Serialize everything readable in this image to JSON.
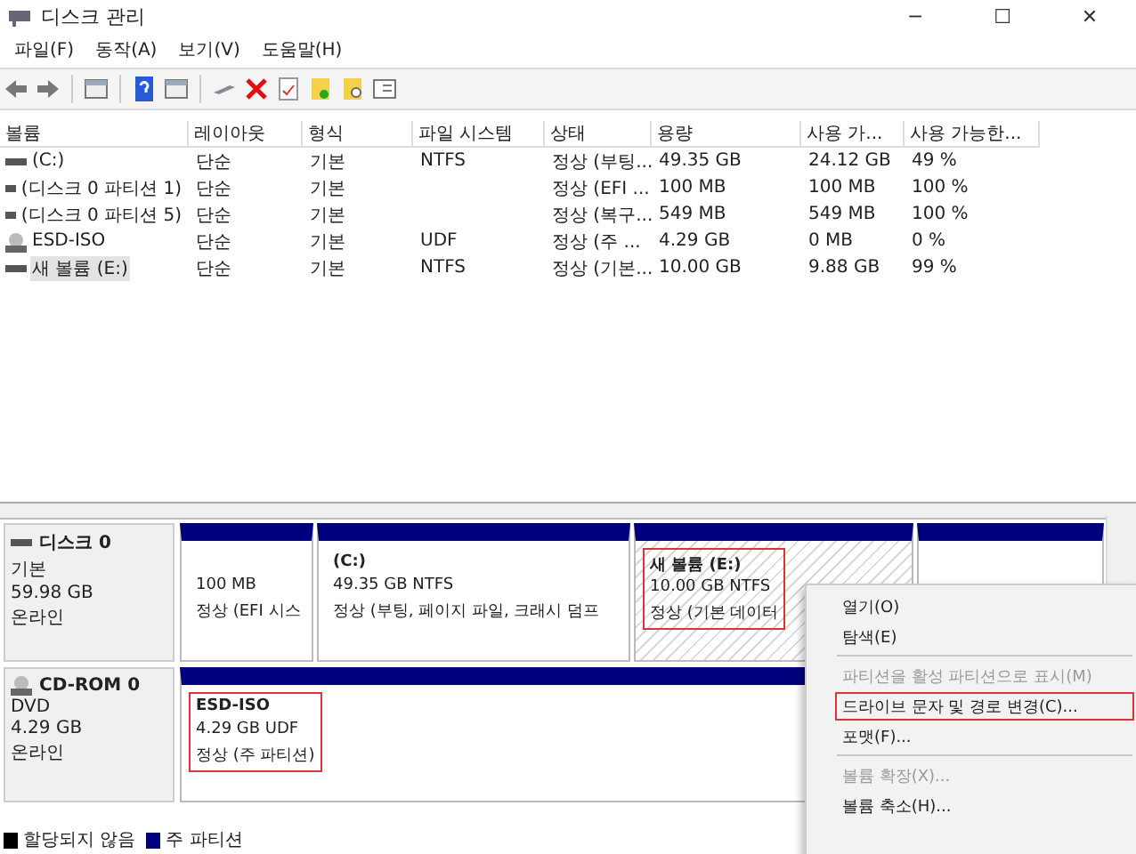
{
  "window": {
    "title": "디스크 관리",
    "controls": [
      "─",
      "☐",
      "✕"
    ]
  },
  "menu": [
    "파일(F)",
    "동작(A)",
    "보기(V)",
    "도움말(H)"
  ],
  "table": {
    "columns": [
      "볼륨",
      "레이아웃",
      "형식",
      "파일 시스템",
      "상태",
      "용량",
      "사용 가...",
      "사용 가능한..."
    ],
    "rows": [
      {
        "kind": "disk",
        "selected": false,
        "cells": [
          "(C:)",
          "단순",
          "기본",
          "NTFS",
          "정상 (부팅...",
          "49.35 GB",
          "24.12 GB",
          "49 %"
        ]
      },
      {
        "kind": "disk",
        "selected": false,
        "cells": [
          "(디스크 0 파티션 1)",
          "단순",
          "기본",
          "",
          "정상 (EFI ...",
          "100 MB",
          "100 MB",
          "100 %"
        ]
      },
      {
        "kind": "disk",
        "selected": false,
        "cells": [
          "(디스크 0 파티션 5)",
          "단순",
          "기본",
          "",
          "정상 (복구...",
          "549 MB",
          "549 MB",
          "100 %"
        ]
      },
      {
        "kind": "cd",
        "selected": false,
        "cells": [
          "ESD-ISO",
          "단순",
          "기본",
          "UDF",
          "정상 (주 ...",
          "4.29 GB",
          "0 MB",
          "0 %"
        ]
      },
      {
        "kind": "disk",
        "selected": true,
        "cells": [
          "새 볼륨 (E:)",
          "단순",
          "기본",
          "NTFS",
          "정상 (기본...",
          "10.00 GB",
          "9.88 GB",
          "99 %"
        ]
      }
    ]
  },
  "disks": [
    {
      "kind": "disk",
      "name": "디스크 0",
      "lines": [
        "기본",
        "59.98 GB",
        "온라인"
      ],
      "partitions": [
        {
          "size": "100 MB",
          "status": "정상 (EFI 시스",
          "selected": false,
          "highlighted": false
        },
        {
          "name": "(C:)",
          "size": "49.35 GB NTFS",
          "status": "정상 (부팅, 페이지 파일, 크래시 덤프",
          "selected": false,
          "highlighted": false
        },
        {
          "name": "새 볼륨  (E:)",
          "size": "10.00 GB NTFS",
          "status": "정상 (기본 데이터",
          "selected": true,
          "highlighted": true
        },
        {
          "selected": false,
          "highlighted": false
        }
      ]
    },
    {
      "kind": "cd",
      "name": "CD-ROM 0",
      "lines": [
        "DVD",
        "4.29 GB",
        "온라인"
      ],
      "partitions": [
        {
          "name": "ESD-ISO",
          "size": "4.29 GB UDF",
          "status": "정상 (주 파티션)",
          "selected": false,
          "highlighted": true
        }
      ]
    }
  ],
  "legend": [
    {
      "label": "할당되지 않음",
      "color": "#000000"
    },
    {
      "label": "주 파티션",
      "color": "#00007f"
    }
  ],
  "context_menu": [
    {
      "label": "열기(O)",
      "disabled": false,
      "highlighted": false,
      "separator_after": false
    },
    {
      "label": "탐색(E)",
      "disabled": false,
      "highlighted": false,
      "separator_after": true
    },
    {
      "label": "파티션을 활성 파티션으로 표시(M)",
      "disabled": true,
      "highlighted": false,
      "separator_after": false
    },
    {
      "label": "드라이브 문자 및 경로 변경(C)...",
      "disabled": false,
      "highlighted": true,
      "separator_after": false
    },
    {
      "label": "포맷(F)...",
      "disabled": false,
      "highlighted": false,
      "separator_after": true
    },
    {
      "label": "볼륨 확장(X)...",
      "disabled": true,
      "highlighted": false,
      "separator_after": false
    },
    {
      "label": "볼륨 축소(H)...",
      "disabled": false,
      "highlighted": false,
      "separator_after": false
    }
  ]
}
